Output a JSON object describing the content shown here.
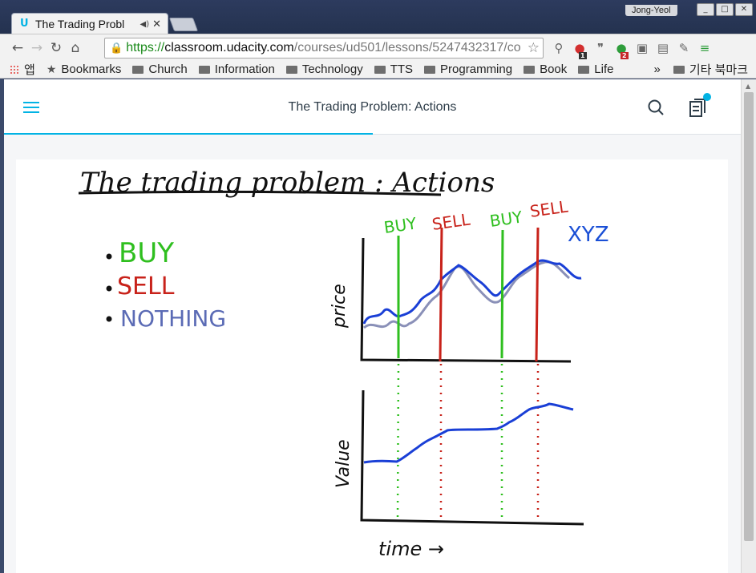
{
  "browser": {
    "tab_title": "The Trading Probl",
    "audio_icon": "speaker-icon",
    "close_icon": "close-icon",
    "profile_name": "Jong-Yeol",
    "url_https": "https://",
    "url_host": "classroom.udacity.com",
    "url_path": "/courses/ud501/lessons/5247432317/co",
    "extension_badges": [
      "1",
      "2"
    ],
    "bookmarks": [
      {
        "label": "앱",
        "icon": "apps-icon"
      },
      {
        "label": "Bookmarks",
        "icon": "star-icon"
      },
      {
        "label": "Church",
        "icon": "folder-icon"
      },
      {
        "label": "Information",
        "icon": "folder-icon"
      },
      {
        "label": "Technology",
        "icon": "folder-icon"
      },
      {
        "label": "TTS",
        "icon": "folder-icon"
      },
      {
        "label": "Programming",
        "icon": "folder-icon"
      },
      {
        "label": "Book",
        "icon": "folder-icon"
      },
      {
        "label": "Life",
        "icon": "folder-icon"
      }
    ],
    "more_label": "»",
    "other_bookmarks": "기타 북마크"
  },
  "header": {
    "title": "The Trading Problem: Actions",
    "progress_fraction": 0.5,
    "accent": "#02b3e4"
  },
  "lesson_image": {
    "title": "The trading problem : Actions",
    "actions": [
      "BUY",
      "SELL",
      "NOTHING"
    ],
    "action_colors": [
      "#2fbf1f",
      "#c8221a",
      "#5b6bb5"
    ],
    "chart_data": {
      "type": "line",
      "top_panel": {
        "ylabel": "price",
        "series_label": "XYZ",
        "markers": [
          {
            "label": "BUY",
            "color": "#2fbf1f"
          },
          {
            "label": "SELL",
            "color": "#c8221a"
          },
          {
            "label": "BUY",
            "color": "#2fbf1f"
          },
          {
            "label": "SELL",
            "color": "#c8221a"
          }
        ]
      },
      "bottom_panel": {
        "ylabel": "Value",
        "xlabel": "time →"
      }
    }
  }
}
